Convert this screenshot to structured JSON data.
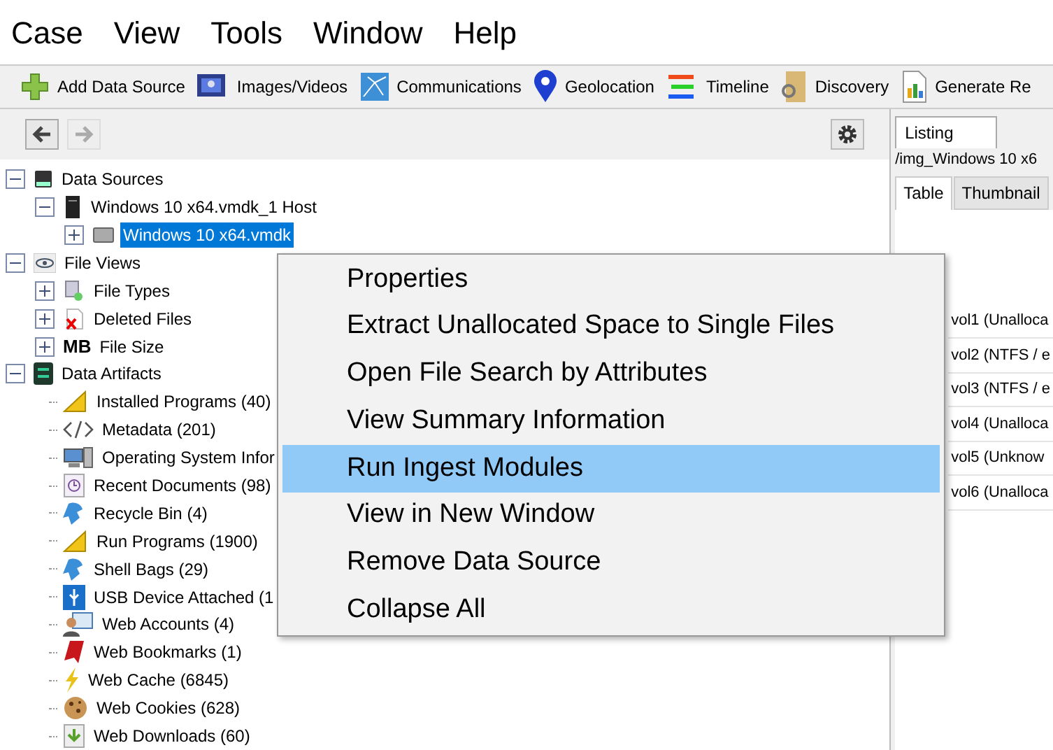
{
  "menu_bar": [
    "Case",
    "View",
    "Tools",
    "Window",
    "Help"
  ],
  "toolbar": [
    "Add Data Source",
    "Images/Videos",
    "Communications",
    "Geolocation",
    "Timeline",
    "Discovery",
    "Generate Re"
  ],
  "tree": [
    {
      "label": "Data Sources",
      "expanded": true,
      "selected": false,
      "children": [
        {
          "label": "Windows 10 x64.vmdk_1 Host",
          "expanded": true,
          "selected": false,
          "children": [
            {
              "label": "Windows 10 x64.vmdk",
              "expanded": false,
              "selected": true
            }
          ]
        }
      ]
    },
    {
      "label": "File Views",
      "expanded": true,
      "selected": false,
      "children": [
        {
          "label": "File Types",
          "expanded": false,
          "selected": false
        },
        {
          "label": "Deleted Files",
          "expanded": false,
          "selected": false
        },
        {
          "label": "File Size",
          "badge": "MB",
          "expanded": false,
          "selected": false
        }
      ]
    },
    {
      "label": "Data Artifacts",
      "expanded": true,
      "selected": false,
      "children": [
        {
          "label": "Installed Programs (40)",
          "selected": false
        },
        {
          "label": "Metadata (201)",
          "selected": false
        },
        {
          "label": "Operating System Infor",
          "selected": false
        },
        {
          "label": "Recent Documents (98)",
          "selected": false
        },
        {
          "label": "Recycle Bin (4)",
          "selected": false
        },
        {
          "label": "Run Programs (1900)",
          "selected": false
        },
        {
          "label": "Shell Bags (29)",
          "selected": false
        },
        {
          "label": "USB Device Attached (1",
          "selected": false
        },
        {
          "label": "Web Accounts (4)",
          "selected": false
        },
        {
          "label": "Web Bookmarks (1)",
          "selected": false
        },
        {
          "label": "Web Cache (6845)",
          "selected": false
        },
        {
          "label": "Web Cookies (628)",
          "selected": false
        },
        {
          "label": "Web Downloads (60)",
          "selected": false
        }
      ]
    }
  ],
  "right_panel": {
    "tab": "Listing",
    "path": "/img_Windows 10 x6",
    "view_tabs": [
      {
        "label": "Table",
        "selected": true
      },
      {
        "label": "Thumbnail",
        "selected": false
      }
    ],
    "rows": [
      "vol1 (Unalloca",
      "vol2 (NTFS / e",
      "vol3 (NTFS / e",
      "vol4 (Unalloca",
      "vol5 (Unknow",
      "vol6 (Unalloca"
    ]
  },
  "context_menu": [
    {
      "label": "Properties",
      "selected": false
    },
    {
      "label": "Extract Unallocated Space to Single Files",
      "selected": false
    },
    {
      "label": "Open File Search by Attributes",
      "selected": false
    },
    {
      "label": "View Summary Information",
      "selected": false
    },
    {
      "label": "Run Ingest Modules",
      "selected": true
    },
    {
      "label": "View in New Window",
      "selected": false
    },
    {
      "label": "Remove Data Source",
      "selected": false
    },
    {
      "label": "Collapse All",
      "selected": false
    }
  ]
}
